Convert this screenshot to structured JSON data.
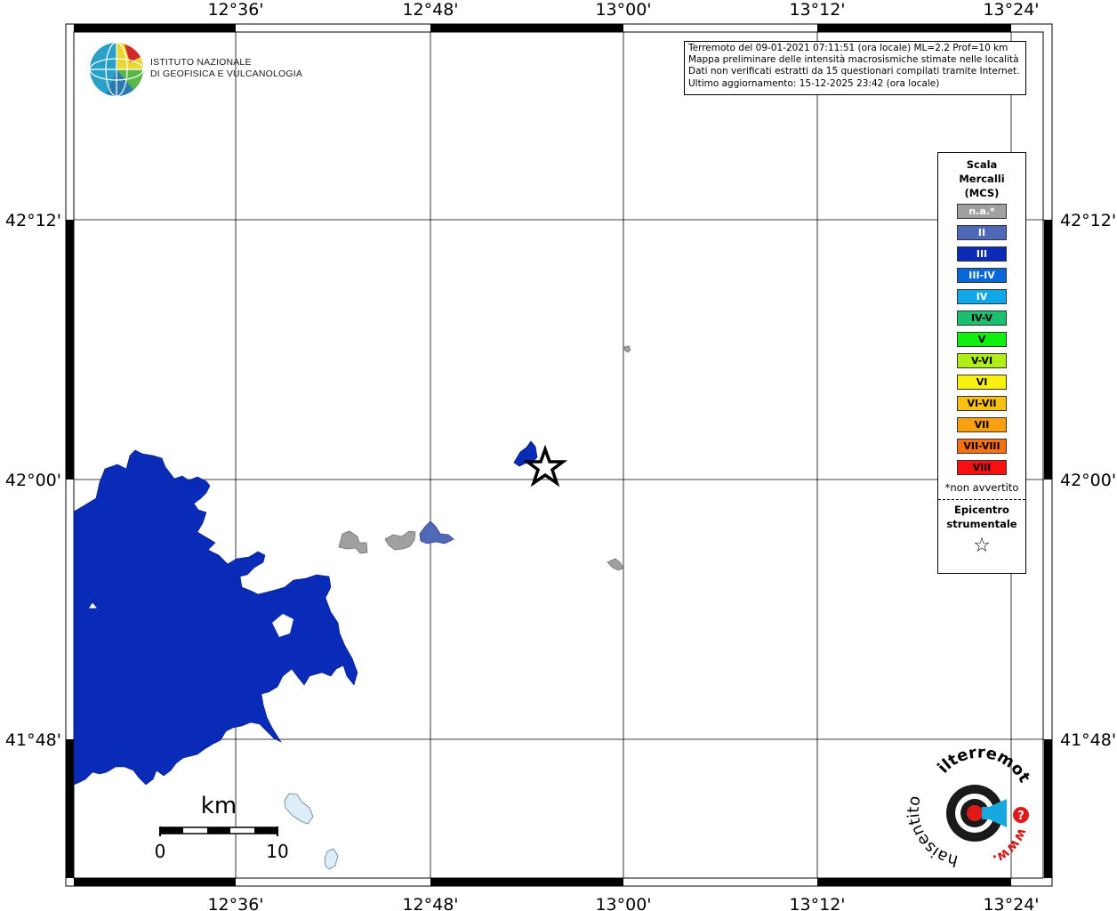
{
  "header": {
    "info_lines": [
      "Terremoto del 09-01-2021 07:11:51 (ora locale) ML=2.2 Prof=10 km",
      "Mappa preliminare delle intensità macrosismiche stimate nelle località",
      "Dati non verificati estratti da 15 questionari compilati tramite Internet.",
      "Ultimo aggiornamento: 15-12-2025 23:42 (ora locale)"
    ]
  },
  "logo": {
    "line1": "ISTITUTO NAZIONALE",
    "line2": "DI GEOFISICA E VULCANOLOGIA",
    "icon": "ingv-globe-icon"
  },
  "axes": {
    "lon_labels": [
      "12°36'",
      "12°48'",
      "13°00'",
      "13°12'",
      "13°24'"
    ],
    "lat_labels": [
      "42°12'",
      "42°00'",
      "41°48'"
    ]
  },
  "legend": {
    "title_lines": [
      "Scala",
      "Mercalli",
      "(MCS)"
    ],
    "items": [
      {
        "label": "n.a.*",
        "color": "#a0a0a0",
        "text_color": "#ffffff"
      },
      {
        "label": "II",
        "color": "#5068b8",
        "text_color": "#ffffff"
      },
      {
        "label": "III",
        "color": "#0a2ab8",
        "text_color": "#ffffff"
      },
      {
        "label": "III-IV",
        "color": "#0868d8",
        "text_color": "#ffffff"
      },
      {
        "label": "IV",
        "color": "#10a8e8",
        "text_color": "#ffffff"
      },
      {
        "label": "IV-V",
        "color": "#18c070",
        "text_color": "#000000"
      },
      {
        "label": "V",
        "color": "#10f010",
        "text_color": "#000000"
      },
      {
        "label": "V-VI",
        "color": "#b0ee18",
        "text_color": "#000000"
      },
      {
        "label": "VI",
        "color": "#f8f010",
        "text_color": "#000000"
      },
      {
        "label": "VI-VII",
        "color": "#f8c010",
        "text_color": "#000000"
      },
      {
        "label": "VII",
        "color": "#f8a010",
        "text_color": "#000000"
      },
      {
        "label": "VII-VIII",
        "color": "#f87010",
        "text_color": "#000000"
      },
      {
        "label": "VIII",
        "color": "#f81010",
        "text_color": "#000000"
      }
    ],
    "note": "*non avvertito",
    "epicenter_lines": [
      "Epicentro",
      "strumentale"
    ],
    "epicenter_symbol": "☆"
  },
  "scale_bar": {
    "unit": "km",
    "start": "0",
    "end": "10"
  },
  "badge": {
    "text_left": "haisentito",
    "text_top": "ilterremoto.it",
    "text_bottom": "www.",
    "icon": "loudspeaker-icon",
    "question_icon": "question-mark-icon"
  },
  "colors": {
    "intensity_III": "#0a2ab8",
    "intensity_II": "#5068b8",
    "not_felt": "#a0a0a0",
    "lake_fill": "#dceefa",
    "grid": "#000000"
  }
}
